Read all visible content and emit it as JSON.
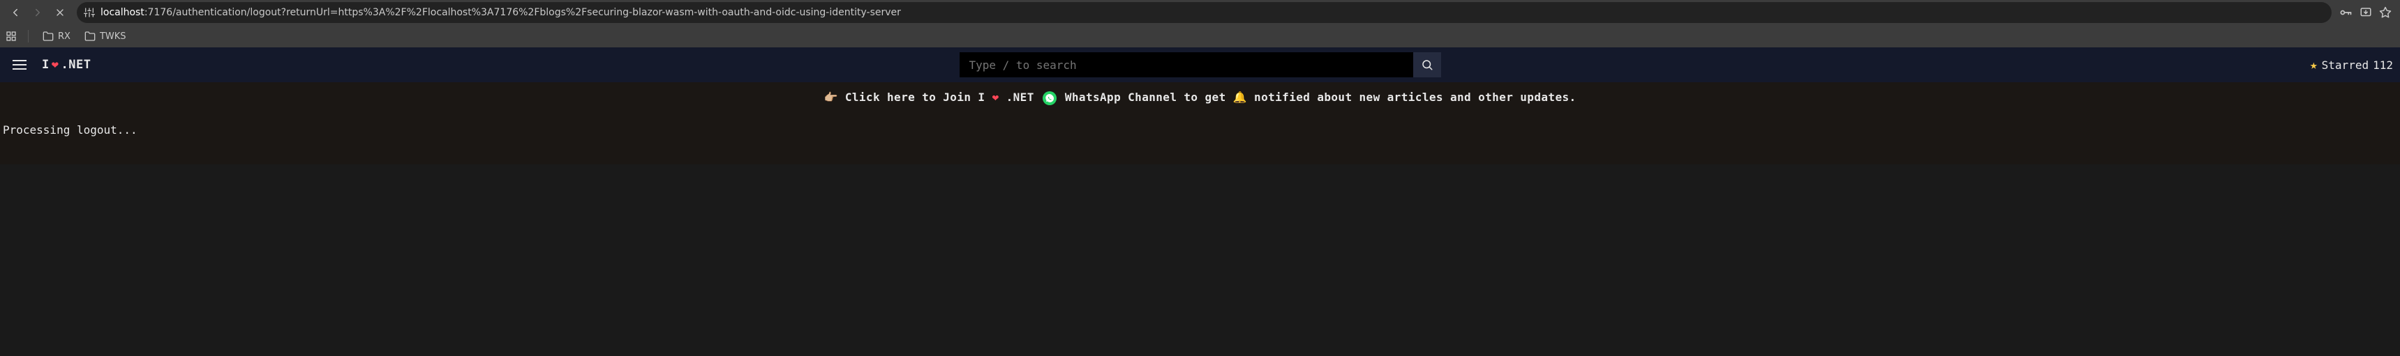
{
  "chrome": {
    "url_host": "localhost",
    "url_rest": ":7176/authentication/logout?returnUrl=https%3A%2F%2Flocalhost%3A7176%2Fblogs%2Fsecuring-blazor-wasm-with-oauth-and-oidc-using-identity-server",
    "bookmarks": {
      "rx": "RX",
      "twks": "TWKS"
    }
  },
  "header": {
    "brand_prefix": "I",
    "brand_heart": "❤",
    "brand_suffix": ".NET",
    "search_placeholder": "Type / to search",
    "starred_label": "Starred",
    "starred_count": "112"
  },
  "banner": {
    "point": "👉🏼",
    "text_left": "Click here to Join I",
    "heart": "❤",
    "text_mid1": ".NET",
    "text_mid2": "WhatsApp Channel to get",
    "bell": "🔔",
    "text_right": "notified about new articles and other updates."
  },
  "content": {
    "status": "Processing logout..."
  }
}
